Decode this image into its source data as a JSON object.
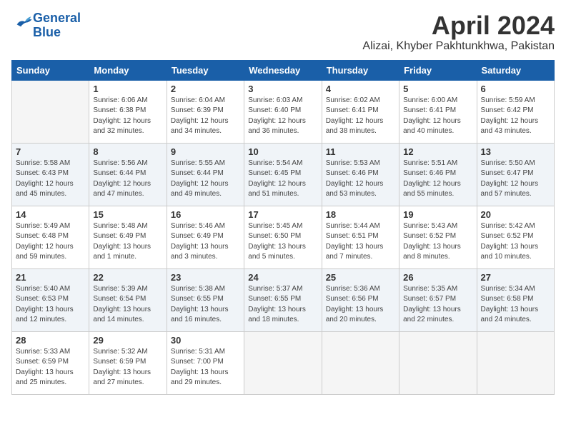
{
  "logo": {
    "line1": "General",
    "line2": "Blue"
  },
  "title": "April 2024",
  "location": "Alizai, Khyber Pakhtunkhwa, Pakistan",
  "days_of_week": [
    "Sunday",
    "Monday",
    "Tuesday",
    "Wednesday",
    "Thursday",
    "Friday",
    "Saturday"
  ],
  "weeks": [
    [
      {
        "day": "",
        "info": ""
      },
      {
        "day": "1",
        "info": "Sunrise: 6:06 AM\nSunset: 6:38 PM\nDaylight: 12 hours\nand 32 minutes."
      },
      {
        "day": "2",
        "info": "Sunrise: 6:04 AM\nSunset: 6:39 PM\nDaylight: 12 hours\nand 34 minutes."
      },
      {
        "day": "3",
        "info": "Sunrise: 6:03 AM\nSunset: 6:40 PM\nDaylight: 12 hours\nand 36 minutes."
      },
      {
        "day": "4",
        "info": "Sunrise: 6:02 AM\nSunset: 6:41 PM\nDaylight: 12 hours\nand 38 minutes."
      },
      {
        "day": "5",
        "info": "Sunrise: 6:00 AM\nSunset: 6:41 PM\nDaylight: 12 hours\nand 40 minutes."
      },
      {
        "day": "6",
        "info": "Sunrise: 5:59 AM\nSunset: 6:42 PM\nDaylight: 12 hours\nand 43 minutes."
      }
    ],
    [
      {
        "day": "7",
        "info": "Sunrise: 5:58 AM\nSunset: 6:43 PM\nDaylight: 12 hours\nand 45 minutes."
      },
      {
        "day": "8",
        "info": "Sunrise: 5:56 AM\nSunset: 6:44 PM\nDaylight: 12 hours\nand 47 minutes."
      },
      {
        "day": "9",
        "info": "Sunrise: 5:55 AM\nSunset: 6:44 PM\nDaylight: 12 hours\nand 49 minutes."
      },
      {
        "day": "10",
        "info": "Sunrise: 5:54 AM\nSunset: 6:45 PM\nDaylight: 12 hours\nand 51 minutes."
      },
      {
        "day": "11",
        "info": "Sunrise: 5:53 AM\nSunset: 6:46 PM\nDaylight: 12 hours\nand 53 minutes."
      },
      {
        "day": "12",
        "info": "Sunrise: 5:51 AM\nSunset: 6:46 PM\nDaylight: 12 hours\nand 55 minutes."
      },
      {
        "day": "13",
        "info": "Sunrise: 5:50 AM\nSunset: 6:47 PM\nDaylight: 12 hours\nand 57 minutes."
      }
    ],
    [
      {
        "day": "14",
        "info": "Sunrise: 5:49 AM\nSunset: 6:48 PM\nDaylight: 12 hours\nand 59 minutes."
      },
      {
        "day": "15",
        "info": "Sunrise: 5:48 AM\nSunset: 6:49 PM\nDaylight: 13 hours\nand 1 minute."
      },
      {
        "day": "16",
        "info": "Sunrise: 5:46 AM\nSunset: 6:49 PM\nDaylight: 13 hours\nand 3 minutes."
      },
      {
        "day": "17",
        "info": "Sunrise: 5:45 AM\nSunset: 6:50 PM\nDaylight: 13 hours\nand 5 minutes."
      },
      {
        "day": "18",
        "info": "Sunrise: 5:44 AM\nSunset: 6:51 PM\nDaylight: 13 hours\nand 7 minutes."
      },
      {
        "day": "19",
        "info": "Sunrise: 5:43 AM\nSunset: 6:52 PM\nDaylight: 13 hours\nand 8 minutes."
      },
      {
        "day": "20",
        "info": "Sunrise: 5:42 AM\nSunset: 6:52 PM\nDaylight: 13 hours\nand 10 minutes."
      }
    ],
    [
      {
        "day": "21",
        "info": "Sunrise: 5:40 AM\nSunset: 6:53 PM\nDaylight: 13 hours\nand 12 minutes."
      },
      {
        "day": "22",
        "info": "Sunrise: 5:39 AM\nSunset: 6:54 PM\nDaylight: 13 hours\nand 14 minutes."
      },
      {
        "day": "23",
        "info": "Sunrise: 5:38 AM\nSunset: 6:55 PM\nDaylight: 13 hours\nand 16 minutes."
      },
      {
        "day": "24",
        "info": "Sunrise: 5:37 AM\nSunset: 6:55 PM\nDaylight: 13 hours\nand 18 minutes."
      },
      {
        "day": "25",
        "info": "Sunrise: 5:36 AM\nSunset: 6:56 PM\nDaylight: 13 hours\nand 20 minutes."
      },
      {
        "day": "26",
        "info": "Sunrise: 5:35 AM\nSunset: 6:57 PM\nDaylight: 13 hours\nand 22 minutes."
      },
      {
        "day": "27",
        "info": "Sunrise: 5:34 AM\nSunset: 6:58 PM\nDaylight: 13 hours\nand 24 minutes."
      }
    ],
    [
      {
        "day": "28",
        "info": "Sunrise: 5:33 AM\nSunset: 6:59 PM\nDaylight: 13 hours\nand 25 minutes."
      },
      {
        "day": "29",
        "info": "Sunrise: 5:32 AM\nSunset: 6:59 PM\nDaylight: 13 hours\nand 27 minutes."
      },
      {
        "day": "30",
        "info": "Sunrise: 5:31 AM\nSunset: 7:00 PM\nDaylight: 13 hours\nand 29 minutes."
      },
      {
        "day": "",
        "info": ""
      },
      {
        "day": "",
        "info": ""
      },
      {
        "day": "",
        "info": ""
      },
      {
        "day": "",
        "info": ""
      }
    ]
  ]
}
